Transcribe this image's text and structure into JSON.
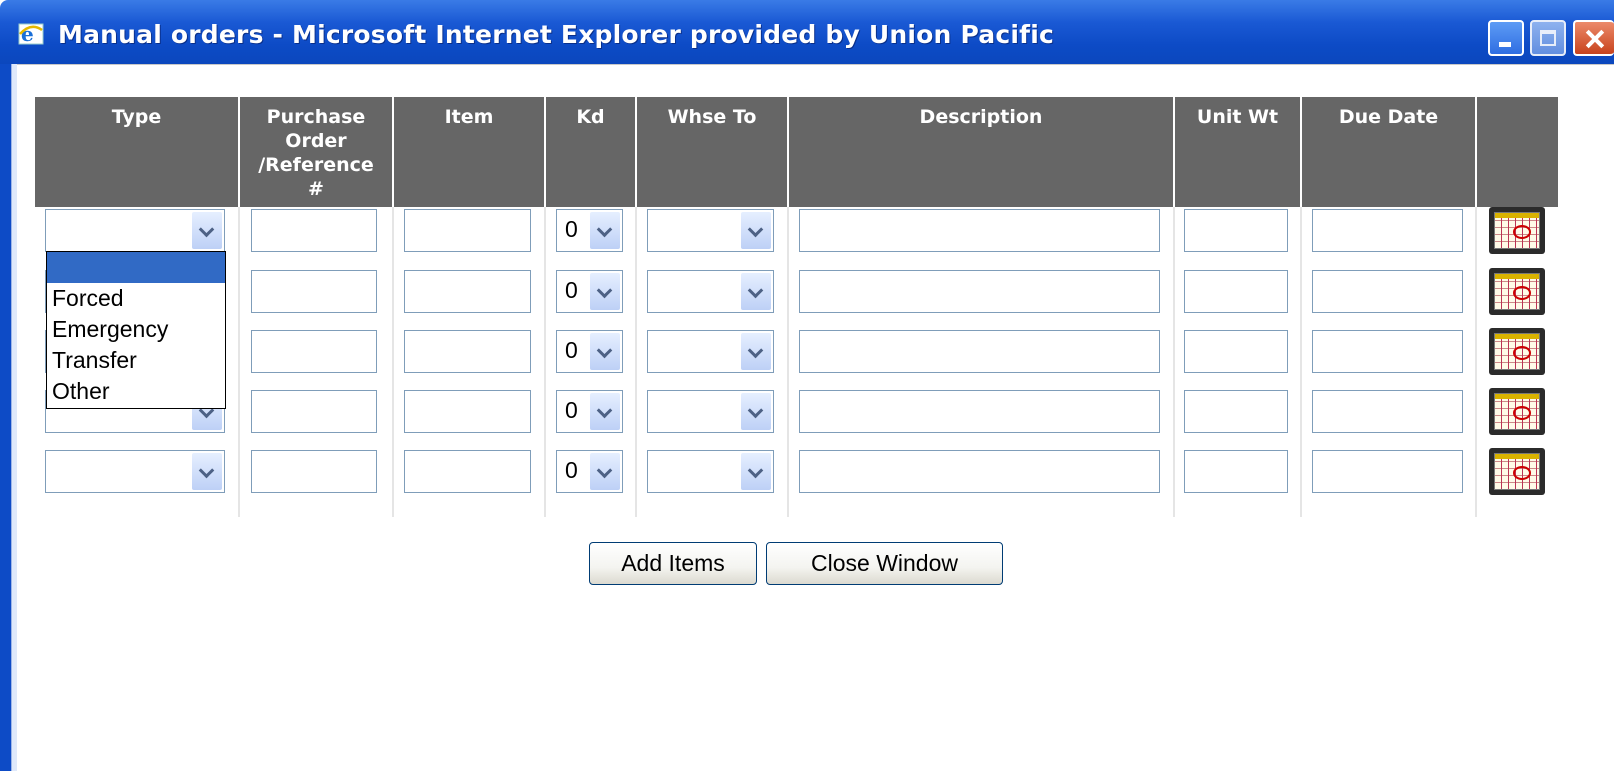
{
  "window": {
    "title": "Manual orders - Microsoft Internet Explorer provided by Union Pacific"
  },
  "table": {
    "headers": {
      "type": "Type",
      "po_line1": "Purchase",
      "po_line2": "Order",
      "po_line3": "/Reference",
      "po_line4": "#",
      "item": "Item",
      "kd": "Kd",
      "whse_to": "Whse To",
      "description": "Description",
      "unit_wt": "Unit Wt",
      "due_date": "Due Date"
    },
    "kd_default": "0",
    "rows": [
      {
        "kd": "0"
      },
      {
        "kd": "0"
      },
      {
        "kd": "0"
      },
      {
        "kd": "0"
      },
      {
        "kd": "0"
      }
    ]
  },
  "type_dropdown": {
    "options": [
      "",
      "Forced",
      "Emergency",
      "Transfer",
      "Other"
    ],
    "highlighted_index": 0
  },
  "buttons": {
    "add_items": "Add Items",
    "close_window": "Close Window"
  },
  "icons": {
    "app": "ie-icon",
    "calendar": "calendar-icon"
  },
  "colors": {
    "titlebar": "#0d4bc6",
    "header_bg": "#666666",
    "highlight": "#316ac5"
  }
}
